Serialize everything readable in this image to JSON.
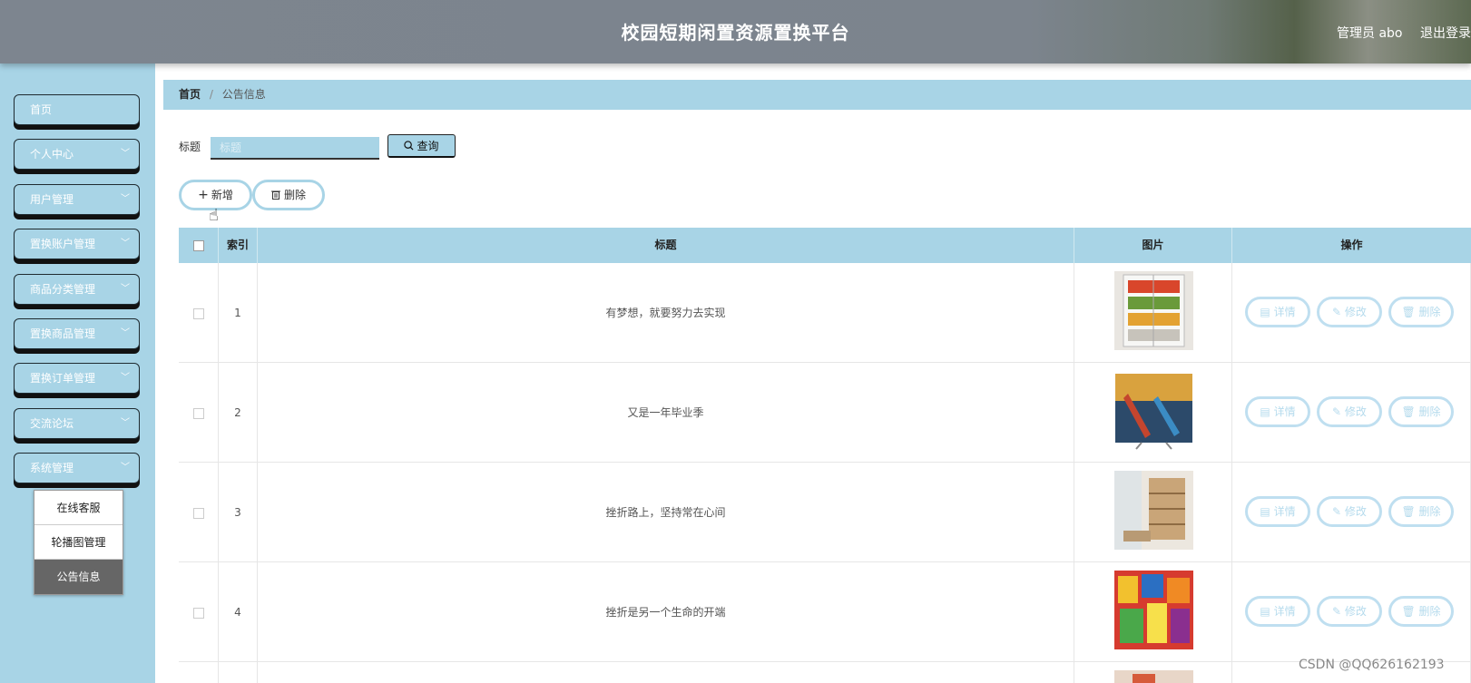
{
  "header": {
    "title": "校园短期闲置资源置换平台",
    "user": "管理员 abo",
    "logout": "退出登录"
  },
  "sidebar": {
    "items": [
      {
        "label": "首页",
        "chevron": false
      },
      {
        "label": "个人中心",
        "chevron": true
      },
      {
        "label": "用户管理",
        "chevron": true
      },
      {
        "label": "置换账户管理",
        "chevron": true
      },
      {
        "label": "商品分类管理",
        "chevron": true
      },
      {
        "label": "置换商品管理",
        "chevron": true
      },
      {
        "label": "置换订单管理",
        "chevron": true
      },
      {
        "label": "交流论坛",
        "chevron": true
      },
      {
        "label": "系统管理",
        "chevron": true
      }
    ],
    "submenu": [
      {
        "label": "在线客服",
        "active": false
      },
      {
        "label": "轮播图管理",
        "active": false
      },
      {
        "label": "公告信息",
        "active": true
      }
    ]
  },
  "breadcrumb": {
    "home": "首页",
    "separator": "/",
    "current": "公告信息"
  },
  "search": {
    "label": "标题",
    "placeholder": "标题",
    "value": "",
    "button": "查询"
  },
  "actions": {
    "add": "新增",
    "delete": "删除"
  },
  "table": {
    "headers": {
      "index": "索引",
      "title": "标题",
      "image": "图片",
      "ops": "操作"
    },
    "op_labels": {
      "detail": "详情",
      "edit": "修改",
      "delete": "删除"
    },
    "rows": [
      {
        "index": "1",
        "title": "有梦想，就要努力去实现",
        "image": "fridge"
      },
      {
        "index": "2",
        "title": "又是一年毕业季",
        "image": "tv-kayaks"
      },
      {
        "index": "3",
        "title": "挫折路上，坚持常在心间",
        "image": "bookshelf-room"
      },
      {
        "index": "4",
        "title": "挫折是另一个生命的开端",
        "image": "snacks"
      }
    ]
  },
  "watermark": "CSDN @QQ626162193",
  "colors": {
    "accent": "#a8d4e6",
    "header": "#7d858f"
  }
}
